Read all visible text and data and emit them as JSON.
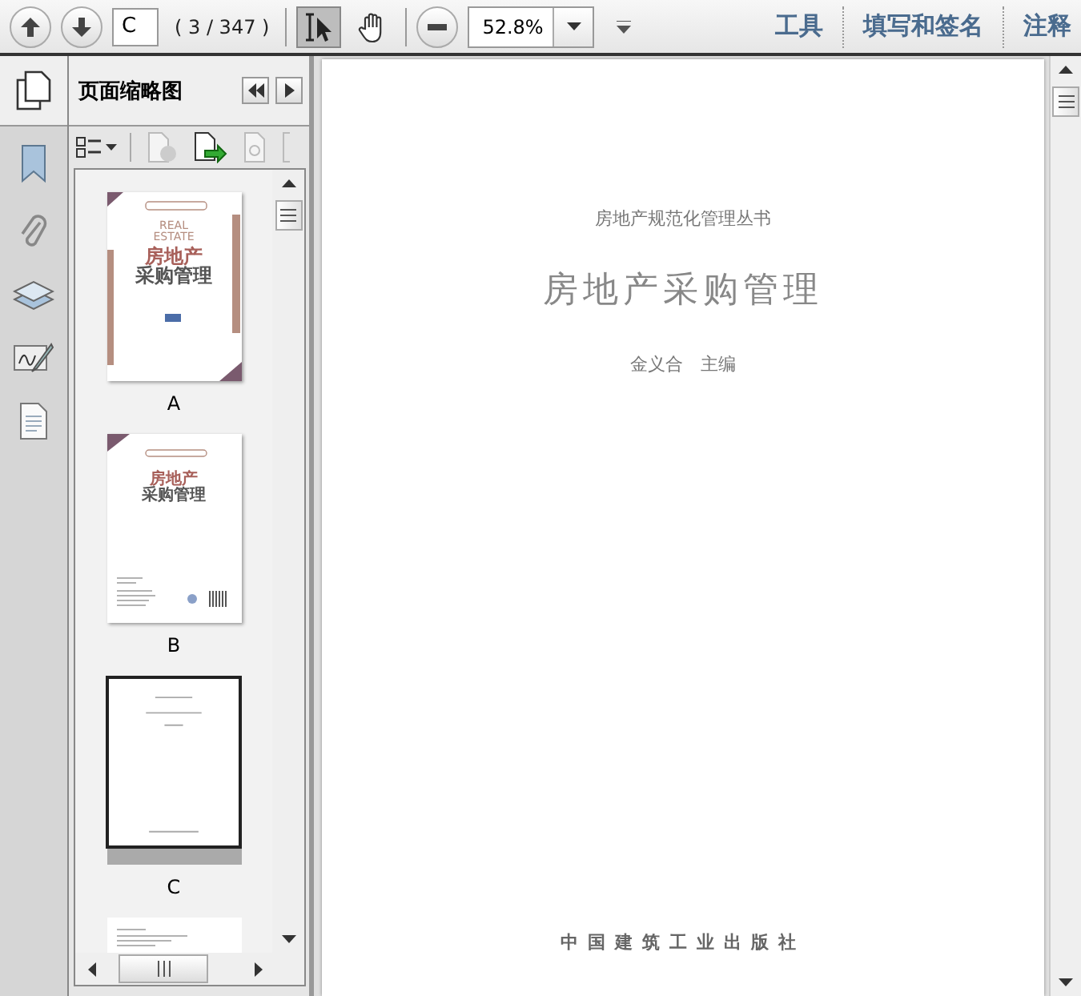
{
  "toolbar": {
    "page_input": {
      "value": "C"
    },
    "page_count": "( 3 / 347 )",
    "tools": [
      {
        "kind": "select",
        "selected": true
      },
      {
        "kind": "hand",
        "selected": false
      }
    ],
    "zoom": {
      "value": "52.8%"
    },
    "links": [
      "工具",
      "填写和签名",
      "注释"
    ]
  },
  "nav_panel": {
    "items": [
      {
        "kind": "bookmark"
      },
      {
        "kind": "attachment"
      },
      {
        "kind": "layers"
      },
      {
        "kind": "signature"
      },
      {
        "kind": "content"
      }
    ]
  },
  "thumbnail_panel": {
    "title": "页面缩略图",
    "thumbnails": [
      {
        "label": "A",
        "kind": "cover",
        "selected": false,
        "texts": [
          "REAL",
          "ESTATE",
          "房地产",
          "采购管理"
        ]
      },
      {
        "label": "B",
        "kind": "back",
        "selected": false,
        "texts": [
          "房地产",
          "采购管理"
        ]
      },
      {
        "label": "C",
        "kind": "title",
        "selected": true
      },
      {
        "kind": "text",
        "selected": false
      }
    ]
  },
  "page": {
    "series": "房地产规范化管理丛书",
    "title": "房地产采购管理",
    "author": "金义合　主编",
    "publisher": "中国建筑工业出版社"
  }
}
